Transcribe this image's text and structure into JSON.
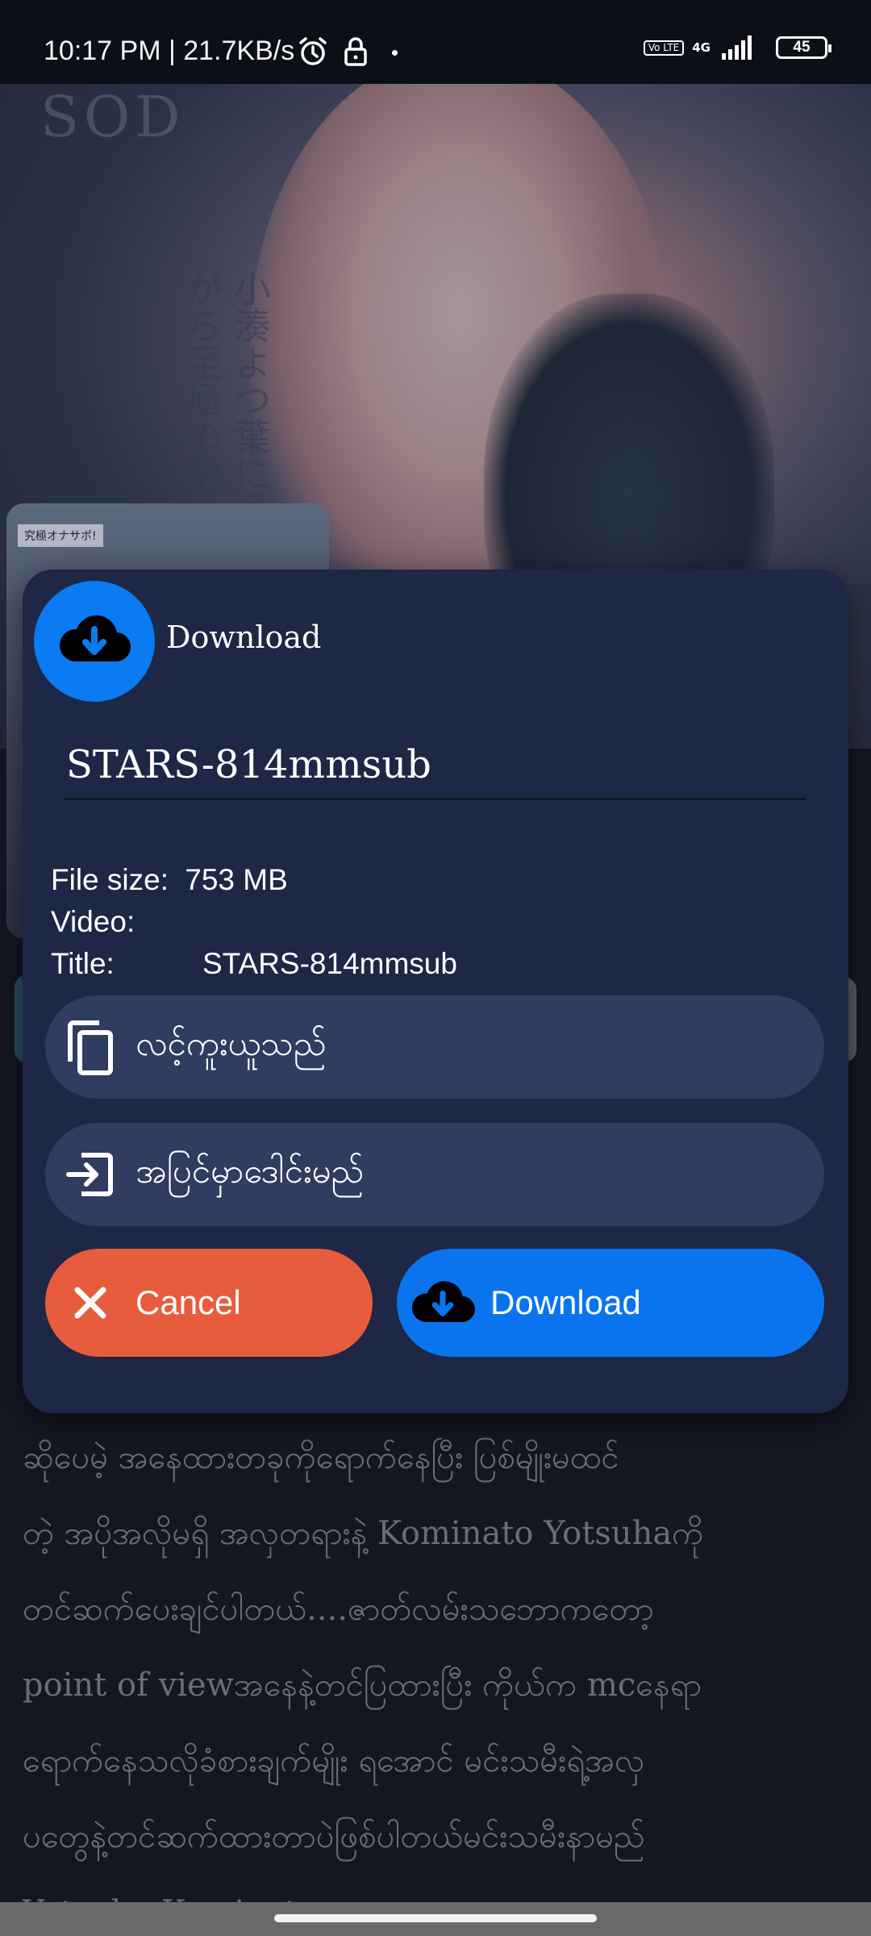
{
  "status_bar": {
    "time": "10:17 PM | 21.7KB/s",
    "volte": "Vo LTE",
    "network": "4G",
    "battery": "45",
    "icons": [
      "alarm-icon",
      "lock-icon",
      "dot-icon",
      "volte-icon",
      "signal-icon",
      "battery-icon"
    ]
  },
  "background": {
    "brand": "SOD",
    "vertical_text": "小湊よつ葉に見つめられながら至極の射精体験!",
    "thumb_badge": "究極オナサポ!"
  },
  "dialog": {
    "title": "Download",
    "header_icon": "cloud-download-icon",
    "filename_value": "STARS-814mmsub",
    "file_size_label": "File size:",
    "file_size_value": "753 MB",
    "video_label": "Video:",
    "video_value": "",
    "title_label": "Title:",
    "title_value": "STARS-814mmsub",
    "copy_link_label": "လင့်ကူးယူသည်",
    "copy_icon": "copy-icon",
    "open_external_label": "အပြင်မှာဒေါင်းမည်",
    "open_icon": "open-external-icon",
    "cancel_label": "Cancel",
    "cancel_icon": "close-icon",
    "download_label": "Download",
    "download_icon": "cloud-download-icon",
    "colors": {
      "dialog_bg": "#1e2745",
      "pill_bg": "#303c60",
      "cancel": "#e85c3e",
      "download": "#0a74ef",
      "header_circle": "#0a7bf0"
    }
  },
  "description": {
    "text": "ဆိုပေမဲ့ အနေထားတခုကိုရောက်နေပြီး ပြစ်မျိုးမထင်\nတဲ့ အပိုအလိုမရှိ အလှတရားနဲ့ Kominato Yotsuhaကို\nတင်ဆက်ပေးချင်ပါတယ်....ဇာတ်လမ်းသဘောကတော့\npoint of viewအနေနဲ့တင်ပြထားပြီး ကိုယ်က mcနေရာ\nရောက်နေသလိုခံစားချက်မျိုး ရအောင် မင်းသမီးရဲ့အလှ\nပတွေနဲ့တင်ဆက်ထားတာပဲဖြစ်ပါတယ်မင်းသမီးနာမည်\nYotsuha Kominato"
  }
}
